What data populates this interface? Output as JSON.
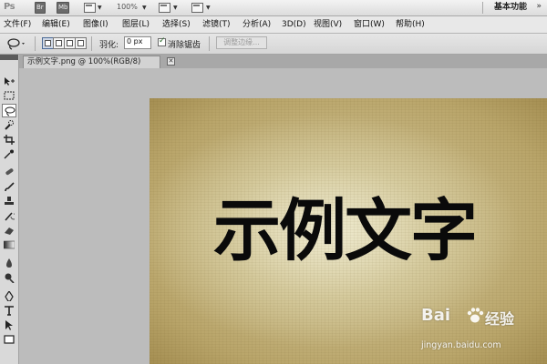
{
  "appbar": {
    "logo": "Ps",
    "bridge_button": "Br",
    "minibridge_button": "Mb",
    "zoom": "100%",
    "workspace": "基本功能",
    "more_arrow": "»"
  },
  "menus": [
    "文件(F)",
    "编辑(E)",
    "图像(I)",
    "图层(L)",
    "选择(S)",
    "滤镜(T)",
    "分析(A)",
    "3D(D)",
    "视图(V)",
    "窗口(W)",
    "帮助(H)"
  ],
  "options": {
    "feather_label": "羽化:",
    "feather_value": "0 px",
    "antialias_label": "消除锯齿",
    "antialias_checked": true,
    "refine_edge_label": "调整边缘..."
  },
  "document": {
    "tab_title": "示例文字.png @ 100%(RGB/8)",
    "close_glyph": "✕",
    "canvas_text": "示例文字"
  },
  "tools": [
    "move-tool",
    "rectangular-marquee-tool",
    "lasso-tool",
    "quick-selection-tool",
    "crop-tool",
    "eyedropper-tool",
    "spot-healing-brush-tool",
    "brush-tool",
    "clone-stamp-tool",
    "history-brush-tool",
    "eraser-tool",
    "gradient-tool",
    "blur-tool",
    "dodge-tool",
    "pen-tool",
    "type-tool",
    "path-selection-tool",
    "rectangle-tool"
  ],
  "selected_tool": "lasso-tool",
  "watermark": {
    "brand": "Bai",
    "label": "经验",
    "url": "jingyan.baidu.com"
  },
  "colors": {
    "selection_blue": "#4b6a96",
    "paper_light": "#ece7cc",
    "paper_dark": "#8d7436",
    "ink": "#0a0a0a"
  }
}
